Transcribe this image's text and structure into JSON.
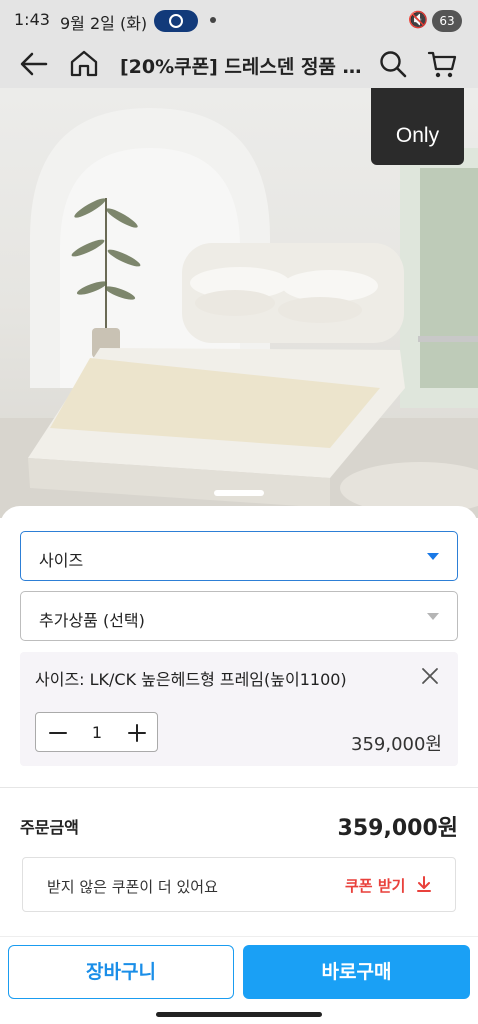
{
  "status_bar": {
    "time": "1:43",
    "date": "9월 2일 (화)",
    "battery": "63"
  },
  "header": {
    "title": "[20%쿠폰] 드레스덴 정품 ..."
  },
  "hero": {
    "badge": "Only",
    "icons": [
      "arrow-left-icon",
      "home-icon",
      "search-icon",
      "cart-icon"
    ]
  },
  "options": {
    "size_select": {
      "label": "사이즈"
    },
    "addon_select": {
      "label": "추가상품 (선택)"
    },
    "selected_item": {
      "name": "사이즈: LK/CK 높은헤드형 프레임(높이1100)",
      "quantity": "1",
      "price": "359,000원"
    }
  },
  "order": {
    "total_label": "주문금액",
    "total_value": "359,000원"
  },
  "coupon": {
    "message": "받지 않은 쿠폰이 더 있어요",
    "action": "쿠폰 받기"
  },
  "actions": {
    "cart_label": "장바구니",
    "buy_label": "바로구매"
  },
  "colors": {
    "accent": "#1aa0f5",
    "coupon_red": "#e9413c",
    "select_border": "#2d7fd6"
  }
}
